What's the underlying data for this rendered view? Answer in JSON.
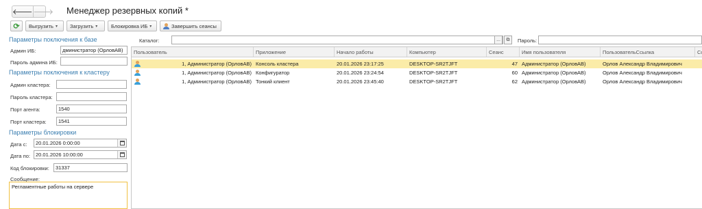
{
  "window": {
    "title": "Менеджер резервных копий *",
    "back_glyph": "🡐",
    "forward_glyph": "🡒"
  },
  "toolbar": {
    "refresh_icon": "refresh-icon",
    "export_label": "Выгрузить",
    "import_label": "Загрузить",
    "block_label": "Блокировка ИБ",
    "end_sessions_label": "Завершить сеансы",
    "dropdown_glyph": "▾"
  },
  "db_params": {
    "title": "Параметры поключения к базе",
    "admin_label": "Админ ИБ:",
    "admin_value": "дминистратор (ОрловАВ)",
    "password_label": "Пароль админа ИБ:",
    "password_value": ""
  },
  "cluster_params": {
    "title": "Параметры поключения к кластеру",
    "admin_label": "Админ кластера:",
    "admin_value": "",
    "password_label": "Пароль кластера:",
    "password_value": "",
    "agent_port_label": "Порт агента:",
    "agent_port_value": "1540",
    "cluster_port_label": "Порт кластера:",
    "cluster_port_value": "1541"
  },
  "block_params": {
    "title": "Параметры блокировки",
    "date_from_label": "Дата с:",
    "date_from_value": "20.01.2026 0:00:00",
    "date_to_label": "Дата по:",
    "date_to_value": "20.01.2026 10:00:00",
    "code_label": "Код блокировки:",
    "code_value": "31337",
    "message_label": "Сообщение:",
    "message_value": "Регламентные работы на сервере"
  },
  "filter": {
    "catalog_label": "Каталог:",
    "catalog_value": "",
    "dots_glyph": "...",
    "copy_glyph": "⧉",
    "password_label": "Пароль:",
    "password_value": ""
  },
  "sessions_table": {
    "columns": [
      "Пользователь",
      "Приложение",
      "Начало работы",
      "Компьютер",
      "Сеанс",
      "Имя пользователя",
      "ПользовательСсылка",
      "Со"
    ],
    "rows": [
      {
        "user": "1, Администратор (ОрловАВ)",
        "app": "Консоль кластера",
        "start": "20.01.2026 23:17:25",
        "computer": "DESKTOP-SR2TJFT",
        "session": "47",
        "username": "Администратор (ОрловАВ)",
        "user_ref": "Орлов Александр Владимирович",
        "selected": true
      },
      {
        "user": "1, Администратор (ОрловАВ)",
        "app": "Конфигуратор",
        "start": "20.01.2026 23:24:54",
        "computer": "DESKTOP-SR2TJFT",
        "session": "60",
        "username": "Администратор (ОрловАВ)",
        "user_ref": "Орлов Александр Владимирович",
        "selected": false
      },
      {
        "user": "1, Администратор (ОрловАВ)",
        "app": "Тонкий клиент",
        "start": "20.01.2026 23:45:40",
        "computer": "DESKTOP-SR2TJFT",
        "session": "62",
        "username": "Администратор (ОрловАВ)",
        "user_ref": "Орлов Александр Владимирович",
        "selected": false
      }
    ]
  },
  "colors": {
    "section_title": "#3c7fb1",
    "selected_row": "#fbeca8",
    "refresh_green": "#3a9a3a"
  }
}
